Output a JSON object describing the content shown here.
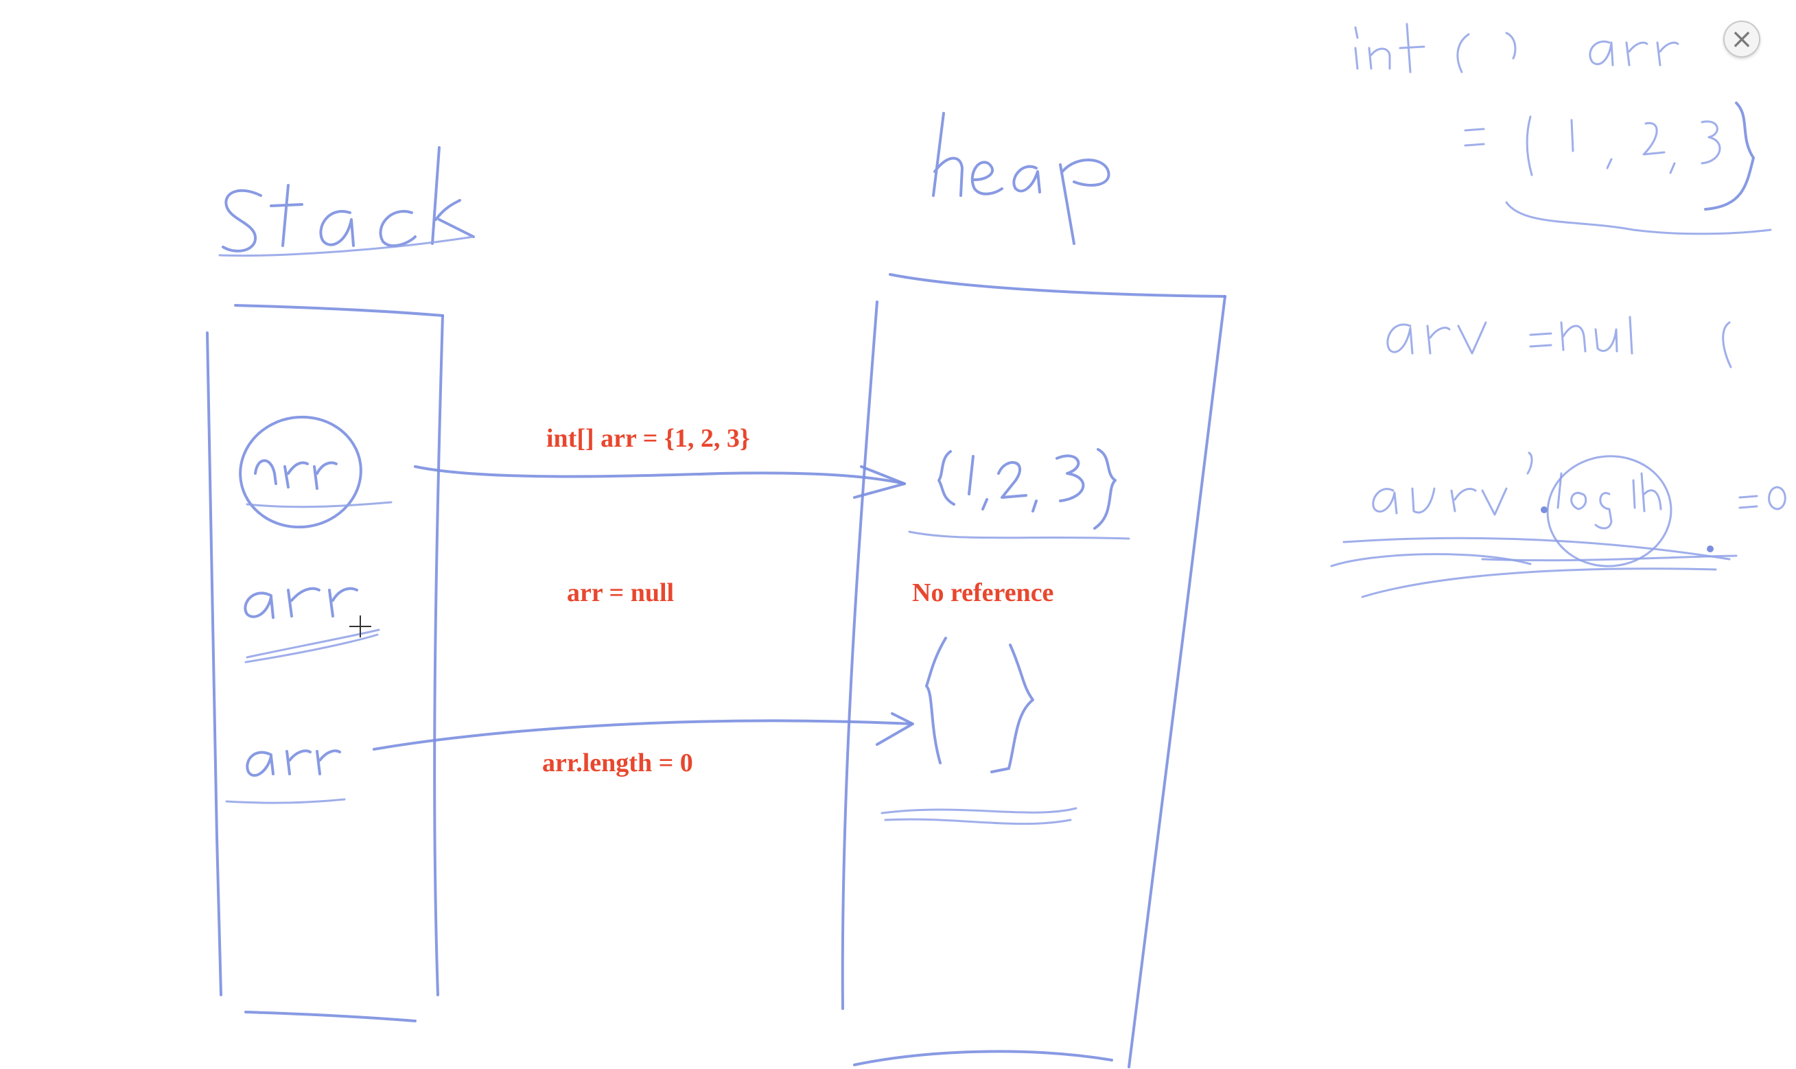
{
  "close": {
    "glyph": "×",
    "icon": "close-icon"
  },
  "annotations": {
    "init": "int[] arr = {1, 2, 3}",
    "null_assign": "arr = null",
    "no_reference": "No reference",
    "length_zero": "arr.length = 0"
  },
  "colors": {
    "ink": "#7b8fe0",
    "annotation": "#e8472e"
  },
  "cursor": {
    "icon": "crosshair-icon"
  }
}
